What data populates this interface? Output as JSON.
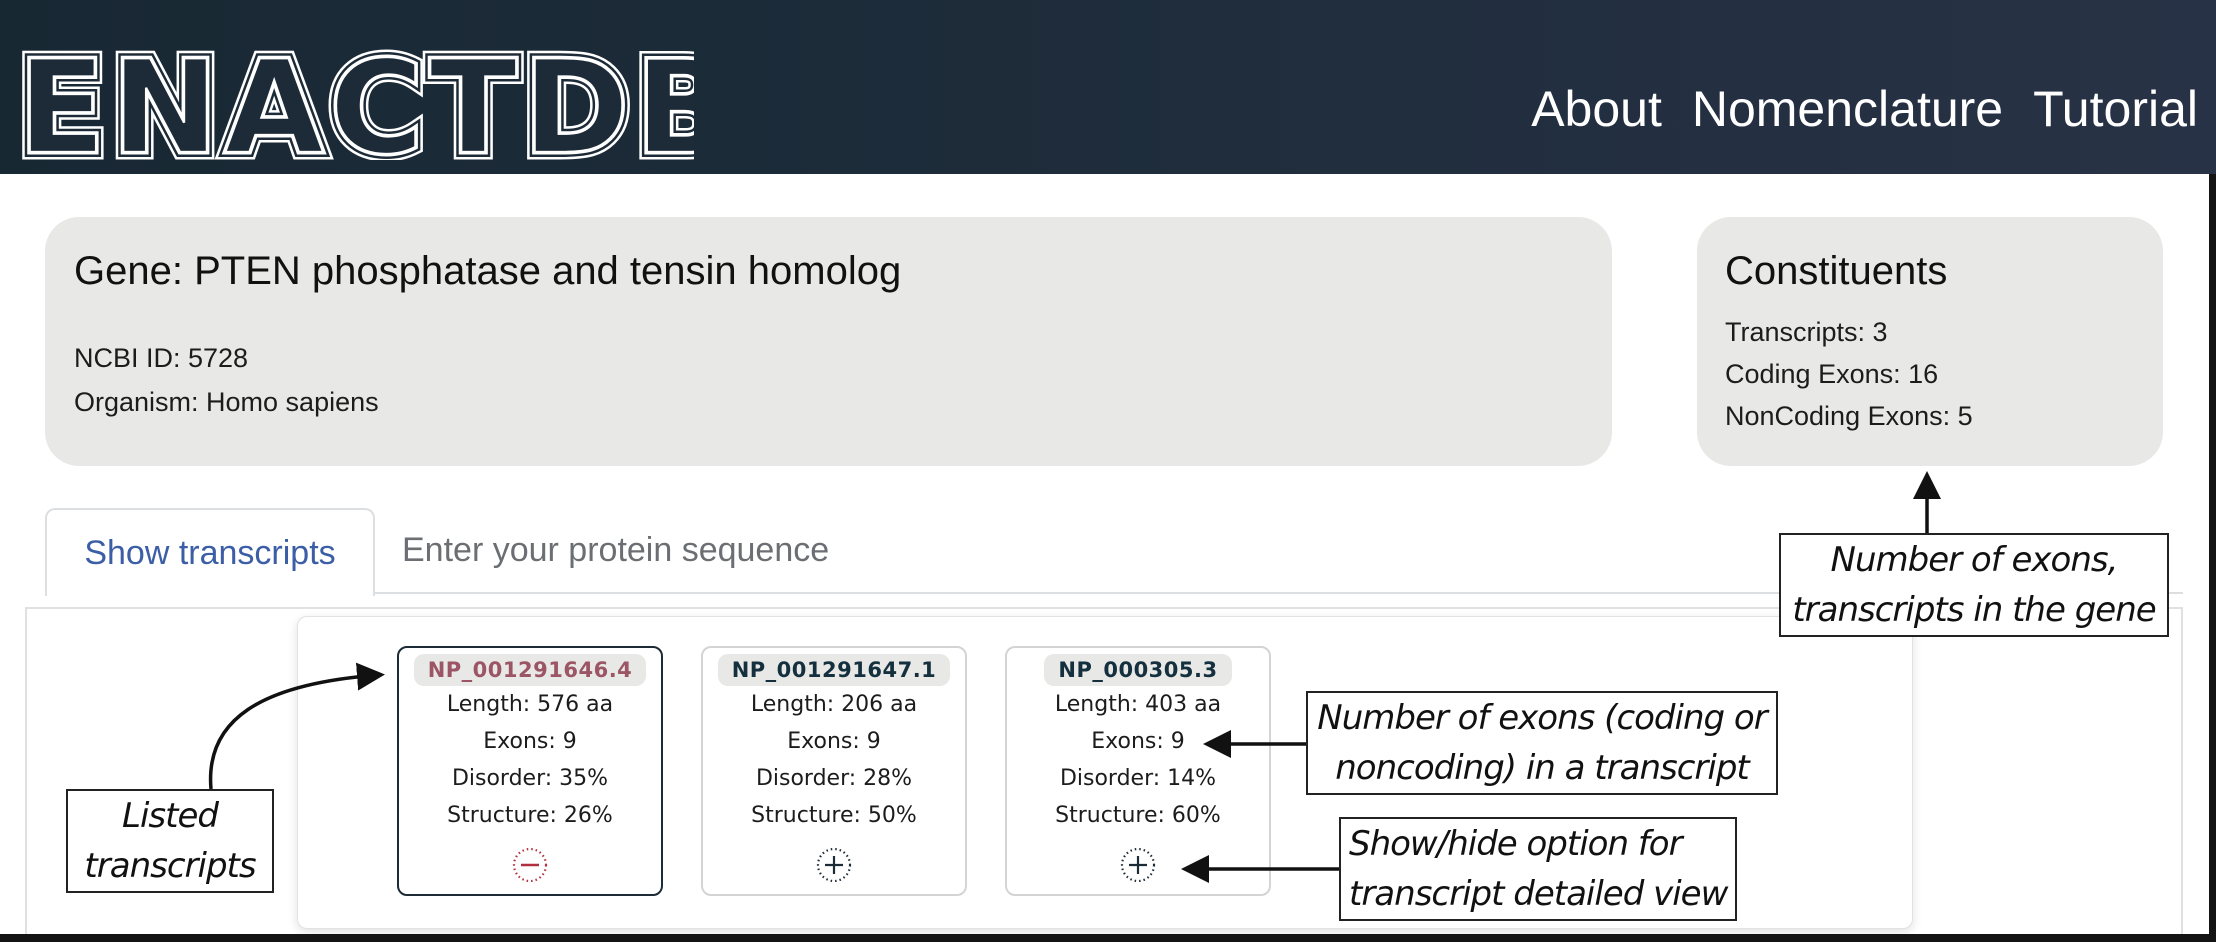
{
  "header": {
    "logo_text": "ENACTDB",
    "nav": [
      {
        "label": "About"
      },
      {
        "label": "Nomenclature"
      },
      {
        "label": "Tutorial"
      }
    ]
  },
  "gene": {
    "title": "Gene: PTEN phosphatase and tensin homolog",
    "ncbi_id": "NCBI ID: 5728",
    "organism": "Organism: Homo sapiens"
  },
  "constituents": {
    "title": "Constituents",
    "transcripts": "Transcripts: 3",
    "coding_exons": "Coding Exons: 16",
    "noncoding_exons": "NonCoding Exons: 5"
  },
  "tabs": [
    {
      "label": "Show transcripts",
      "active": true
    },
    {
      "label": "Enter your protein sequence",
      "active": false
    }
  ],
  "transcripts": [
    {
      "id": "NP_001291646.4",
      "length": "Length: 576 aa",
      "exons": "Exons: 9",
      "disorder": "Disorder: 35%",
      "structure": "Structure: 26%",
      "toggle": "minus-icon",
      "expanded": true
    },
    {
      "id": "NP_001291647.1",
      "length": "Length: 206 aa",
      "exons": "Exons: 9",
      "disorder": "Disorder: 28%",
      "structure": "Structure: 50%",
      "toggle": "plus-icon",
      "expanded": false
    },
    {
      "id": "NP_000305.3",
      "length": "Length: 403 aa",
      "exons": "Exons: 9",
      "disorder": "Disorder: 14%",
      "structure": "Structure: 60%",
      "toggle": "plus-icon",
      "expanded": false
    }
  ],
  "annotations": {
    "listed": {
      "line1": "Listed",
      "line2": "transcripts"
    },
    "gene_counts": {
      "line1": "Number of exons,",
      "line2": "transcripts in the gene"
    },
    "transcript_exons": {
      "line1": "Number of exons (coding or",
      "line2": "noncoding) in a transcript"
    },
    "toggle_view": {
      "line1": "Show/hide option for",
      "line2": "transcript detailed view"
    }
  },
  "colors": {
    "header_left": "#182833",
    "header_right": "#283246",
    "card_bg": "#e8e8e6",
    "tab_active": "#3b5ea6",
    "selected_id": "#9b5564",
    "toggle_minus": "#b03040"
  }
}
